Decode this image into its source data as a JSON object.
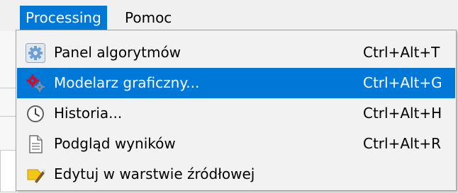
{
  "menubar": {
    "processing": "Processing",
    "help": "Pomoc"
  },
  "menu": {
    "items": [
      {
        "label": "Panel algorytmów",
        "shortcut": "Ctrl+Alt+T",
        "icon": "gear-icon",
        "highlighted": false
      },
      {
        "label": "Modelarz graficzny...",
        "shortcut": "Ctrl+Alt+G",
        "icon": "model-gears-icon",
        "highlighted": true
      },
      {
        "label": "Historia...",
        "shortcut": "Ctrl+Alt+H",
        "icon": "clock-icon",
        "highlighted": false
      },
      {
        "label": "Podgląd wyników",
        "shortcut": "Ctrl+Alt+R",
        "icon": "document-icon",
        "highlighted": false
      },
      {
        "label": "Edytuj w warstwie źródłowej",
        "shortcut": "",
        "icon": "edit-tag-icon",
        "highlighted": false
      }
    ]
  },
  "colors": {
    "highlight": "#0078d7",
    "menu_background": "#f2f2f2"
  }
}
